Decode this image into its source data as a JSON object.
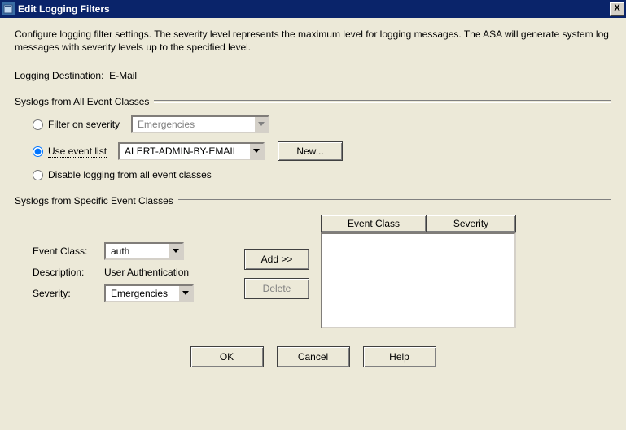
{
  "window": {
    "title": "Edit Logging Filters",
    "close_glyph": "X"
  },
  "description": "Configure logging filter settings. The severity level represents the maximum level for logging messages. The ASA will generate system log messages with severity levels up to the specified level.",
  "destination": {
    "label": "Logging Destination:",
    "value": "E-Mail"
  },
  "group_all": {
    "title": "Syslogs from All Event Classes",
    "filter_on_severity_label": "Filter on severity",
    "severity_value": "Emergencies",
    "use_event_list_label": "Use event list",
    "event_list_value": "ALERT-ADMIN-BY-EMAIL",
    "new_button": "New...",
    "disable_label": "Disable logging from all event classes",
    "selected": "use_event_list"
  },
  "group_specific": {
    "title": "Syslogs from Specific Event Classes",
    "event_class_label": "Event Class:",
    "event_class_value": "auth",
    "description_label": "Description:",
    "description_value": "User Authentication",
    "severity_label": "Severity:",
    "severity_value": "Emergencies",
    "add_button": "Add >>",
    "delete_button": "Delete",
    "table_headers": {
      "event_class": "Event Class",
      "severity": "Severity"
    }
  },
  "buttons": {
    "ok": "OK",
    "cancel": "Cancel",
    "help": "Help"
  }
}
